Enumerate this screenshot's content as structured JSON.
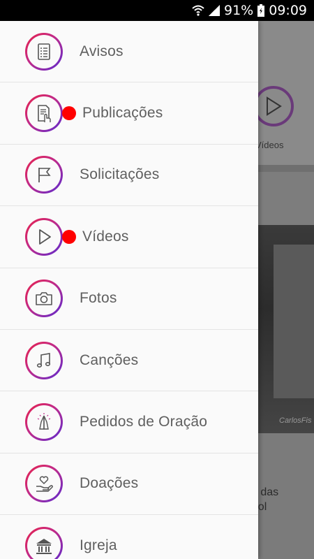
{
  "status_bar": {
    "battery_percent": "91%",
    "time": "09:09",
    "icons": [
      "wifi-icon",
      "signal-icon",
      "battery-icon"
    ]
  },
  "background_app": {
    "video_label": "Vídeos",
    "photo_credit": "CarlosFis",
    "news_text_line1": "as das",
    "news_text_line2": "ebol"
  },
  "drawer": {
    "items": [
      {
        "label": "Avisos",
        "icon": "list-document-icon",
        "badge": false
      },
      {
        "label": "Publicações",
        "icon": "document-touch-icon",
        "badge": true
      },
      {
        "label": "Solicitações",
        "icon": "flag-icon",
        "badge": false
      },
      {
        "label": "Vídeos",
        "icon": "play-icon",
        "badge": true
      },
      {
        "label": "Fotos",
        "icon": "camera-icon",
        "badge": false
      },
      {
        "label": "Canções",
        "icon": "music-note-icon",
        "badge": false
      },
      {
        "label": "Pedidos de Oração",
        "icon": "praying-hands-icon",
        "badge": false
      },
      {
        "label": "Doações",
        "icon": "heart-hand-icon",
        "badge": false
      },
      {
        "label": "Igreja",
        "icon": "church-building-icon",
        "badge": false
      }
    ]
  },
  "colors": {
    "accent_gradient_start": "#e8224a",
    "accent_gradient_end": "#5a2ad0",
    "badge": "#ff0000",
    "label": "#5f5f5f"
  }
}
